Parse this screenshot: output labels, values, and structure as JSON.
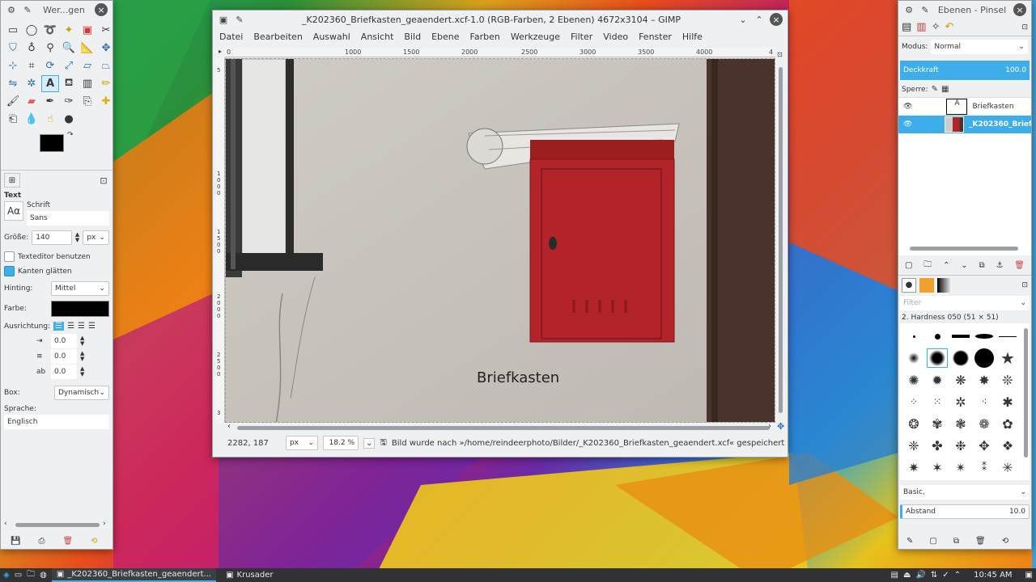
{
  "toolbox": {
    "title": "Wer...gen",
    "tool_options_title": "Text",
    "font_label": "Schrift",
    "font_value": "Sans",
    "size_label": "Größe:",
    "size_value": "140",
    "size_unit": "px",
    "texteditor_label": "Texteditor benutzen",
    "antialias_label": "Kanten glätten",
    "hinting_label": "Hinting:",
    "hinting_value": "Mittel",
    "color_label": "Farbe:",
    "justify_label": "Ausrichtung:",
    "indent_value": "0.0",
    "linespacing_value": "0.0",
    "letterspacing_value": "0.0",
    "box_label": "Box:",
    "box_value": "Dynamisch",
    "language_label": "Sprache:",
    "language_value": "Englisch",
    "font_sample": "Aα",
    "fg_color": "#000000",
    "bg_color": "#ffffff"
  },
  "main": {
    "title": "_K202360_Briefkasten_geaendert.xcf-1.0 (RGB-Farben, 2 Ebenen) 4672x3104 – GIMP",
    "menu": [
      "Datei",
      "Bearbeiten",
      "Auswahl",
      "Ansicht",
      "Bild",
      "Ebene",
      "Farben",
      "Werkzeuge",
      "Filter",
      "Video",
      "Fenster",
      "Hilfe"
    ],
    "ruler_ticks": [
      "0",
      "1000",
      "1500",
      "2000",
      "2500",
      "3000",
      "3500",
      "4000",
      "4"
    ],
    "vruler_ticks": [
      "5",
      "1\n0\n0\n0",
      "1\n5\n0\n0",
      "2\n0\n0\n0",
      "2\n5\n0\n0",
      "3"
    ],
    "canvas_text": "Briefkasten",
    "coords": "2282, 187",
    "unit": "px",
    "zoom": "18.2 %",
    "status_message": "Bild wurde nach »/home/reindeerphoto/Bilder/_K202360_Briefkasten_geaendert.xcf« gespeichert"
  },
  "dock": {
    "title": "Ebenen - Pinsel",
    "mode_label": "Modus:",
    "mode_value": "Normal",
    "opacity_label": "Deckkraft",
    "opacity_value": "100.0",
    "lock_label": "Sperre:",
    "layers": [
      {
        "name": "Briefkasten",
        "selected": false
      },
      {
        "name": "_K202360_Briefk",
        "selected": true
      }
    ],
    "filter_placeholder": "Filter",
    "brush_name": "2. Hardness 050 (51 × 51)",
    "brush_set": "Basic,",
    "spacing_label": "Abstand",
    "spacing_value": "10.0"
  },
  "taskbar": {
    "tasks": [
      {
        "label": "_K202360_Briefkasten_geaendert...",
        "active": true
      },
      {
        "label": "Krusader",
        "active": false
      }
    ],
    "clock": "10:45 AM"
  }
}
